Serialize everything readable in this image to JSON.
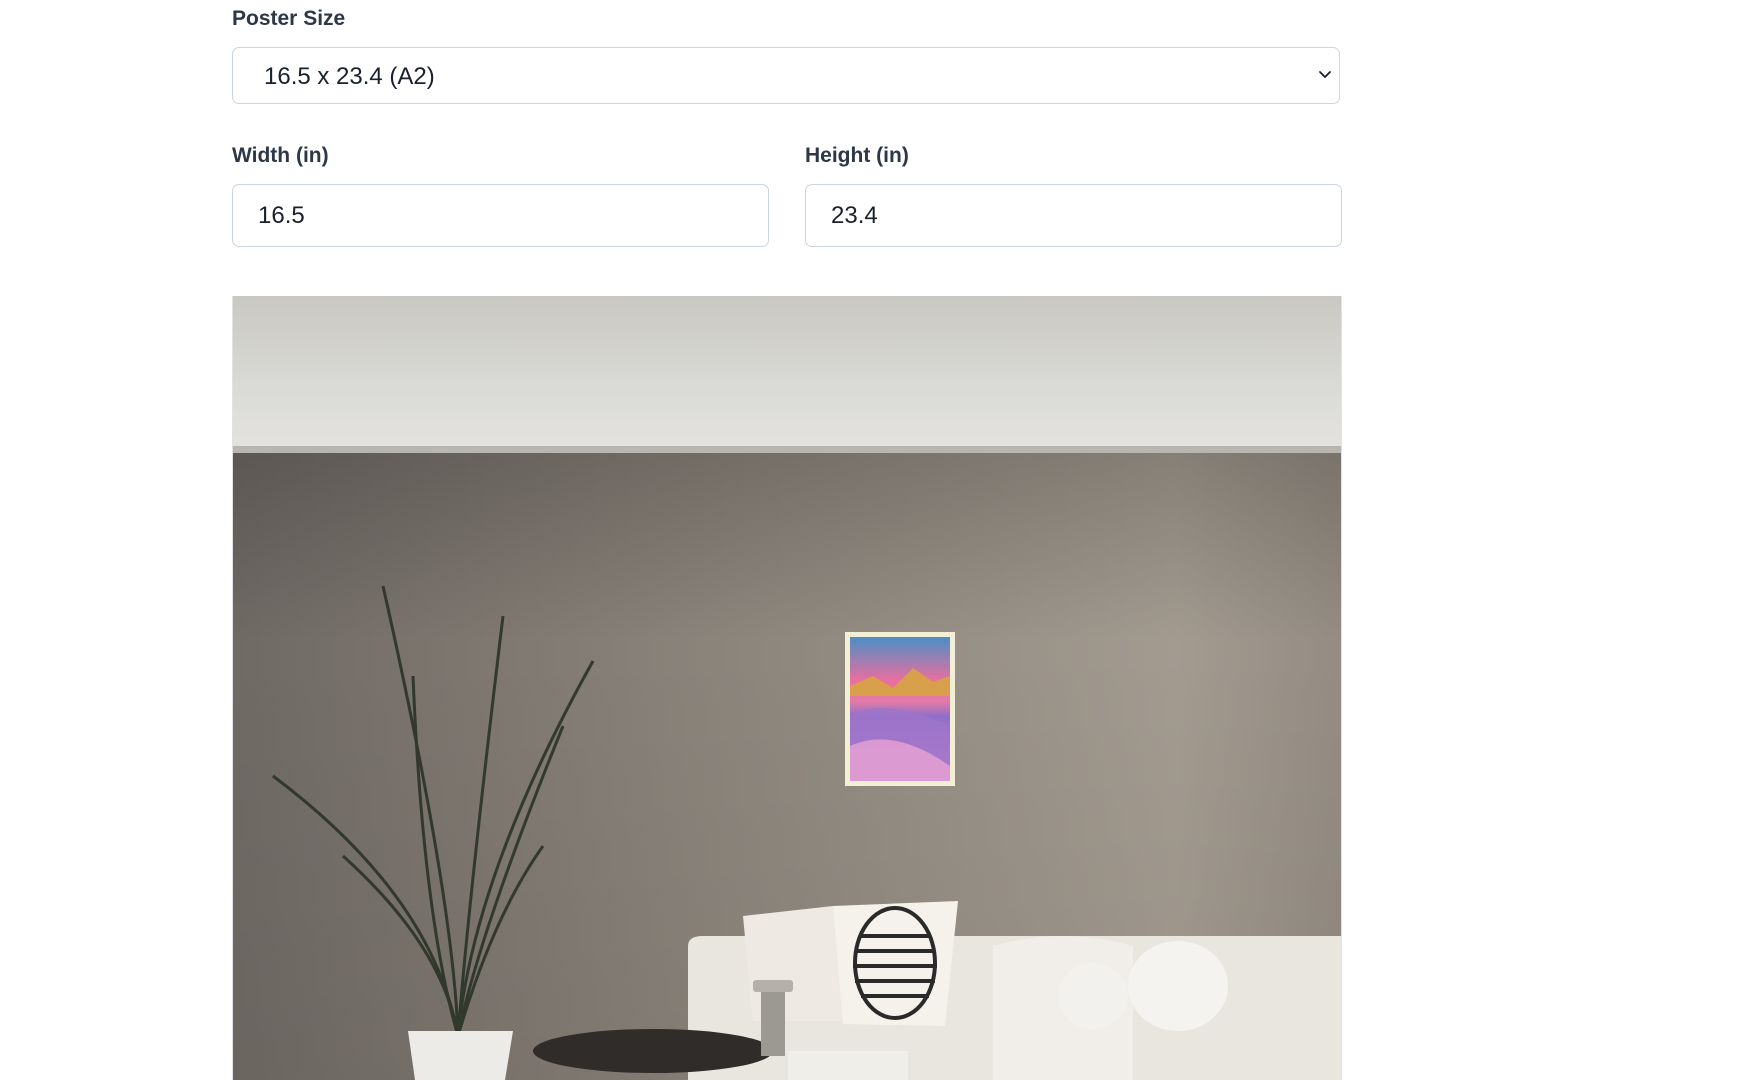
{
  "poster_size": {
    "label": "Poster Size",
    "selected": "16.5 x 23.4 (A2)"
  },
  "width": {
    "label": "Width (in)",
    "value": "16.5"
  },
  "height": {
    "label": "Height (in)",
    "value": "23.4"
  },
  "icons": {
    "select": "chevron-down-icon"
  },
  "colors": {
    "border": "#cbd5e0",
    "label": "#2d3748",
    "wall": "#8a8278",
    "ceiling": "#d6d4cf"
  }
}
